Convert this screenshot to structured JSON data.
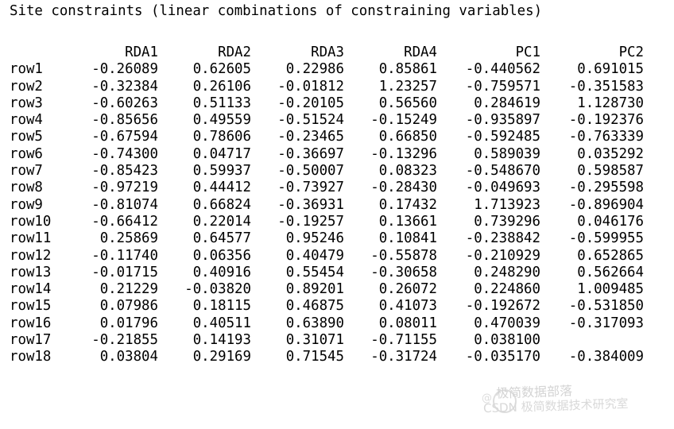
{
  "console": {
    "title": "Site constraints (linear combinations of constraining variables)",
    "background_color": "#ffffff",
    "text_color": "#000000"
  },
  "table": {
    "row_label_header": "",
    "columns": [
      "RDA1",
      "RDA2",
      "RDA3",
      "RDA4",
      "PC1",
      "PC2"
    ],
    "rows": [
      {
        "label": "row1",
        "values": [
          "-0.26089",
          "0.62605",
          "0.22986",
          "0.85861",
          "-0.440562",
          "0.691015"
        ]
      },
      {
        "label": "row2",
        "values": [
          "-0.32384",
          "0.26106",
          "-0.01812",
          "1.23257",
          "-0.759571",
          "-0.351583"
        ]
      },
      {
        "label": "row3",
        "values": [
          "-0.60263",
          "0.51133",
          "-0.20105",
          "0.56560",
          "0.284619",
          "1.128730"
        ]
      },
      {
        "label": "row4",
        "values": [
          "-0.85656",
          "0.49559",
          "-0.51524",
          "-0.15249",
          "-0.935897",
          "-0.192376"
        ]
      },
      {
        "label": "row5",
        "values": [
          "-0.67594",
          "0.78606",
          "-0.23465",
          "0.66850",
          "-0.592485",
          "-0.763339"
        ]
      },
      {
        "label": "row6",
        "values": [
          "-0.74300",
          "0.04717",
          "-0.36697",
          "-0.13296",
          "0.589039",
          "0.035292"
        ]
      },
      {
        "label": "row7",
        "values": [
          "-0.85423",
          "0.59937",
          "-0.50007",
          "0.08323",
          "-0.548670",
          "0.598587"
        ]
      },
      {
        "label": "row8",
        "values": [
          "-0.97219",
          "0.44412",
          "-0.73927",
          "-0.28430",
          "-0.049693",
          "-0.295598"
        ]
      },
      {
        "label": "row9",
        "values": [
          "-0.81074",
          "0.66824",
          "-0.36931",
          "0.17432",
          "1.713923",
          "-0.896904"
        ]
      },
      {
        "label": "row10",
        "values": [
          "-0.66412",
          "0.22014",
          "-0.19257",
          "0.13661",
          "0.739296",
          "0.046176"
        ]
      },
      {
        "label": "row11",
        "values": [
          "0.25869",
          "0.64577",
          "0.95246",
          "0.10841",
          "-0.238842",
          "-0.599955"
        ]
      },
      {
        "label": "row12",
        "values": [
          "-0.11740",
          "0.06356",
          "0.40479",
          "-0.55878",
          "-0.210929",
          "0.652865"
        ]
      },
      {
        "label": "row13",
        "values": [
          "-0.01715",
          "0.40916",
          "0.55454",
          "-0.30658",
          "0.248290",
          "0.562664"
        ]
      },
      {
        "label": "row14",
        "values": [
          "0.21229",
          "-0.03820",
          "0.89201",
          "0.26072",
          "0.224860",
          "1.009485"
        ]
      },
      {
        "label": "row15",
        "values": [
          "0.07986",
          "0.18115",
          "0.46875",
          "0.41073",
          "-0.192672",
          "-0.531850"
        ]
      },
      {
        "label": "row16",
        "values": [
          "0.01796",
          "0.40511",
          "0.63890",
          "0.08011",
          "0.470039",
          "-0.317093"
        ]
      },
      {
        "label": "row17",
        "values": [
          "-0.21855",
          "0.14193",
          "0.31071",
          "-0.71155",
          "0.038100",
          ""
        ]
      },
      {
        "label": "row18",
        "values": [
          "0.03804",
          "0.29169",
          "0.71545",
          "-0.31724",
          "-0.035170",
          "-0.384009"
        ]
      }
    ]
  },
  "watermark": {
    "badge": "@",
    "line1": "极简数据部落",
    "line2": "CSDN 极简数据技术研究室",
    "color": "#9a9a9a"
  }
}
